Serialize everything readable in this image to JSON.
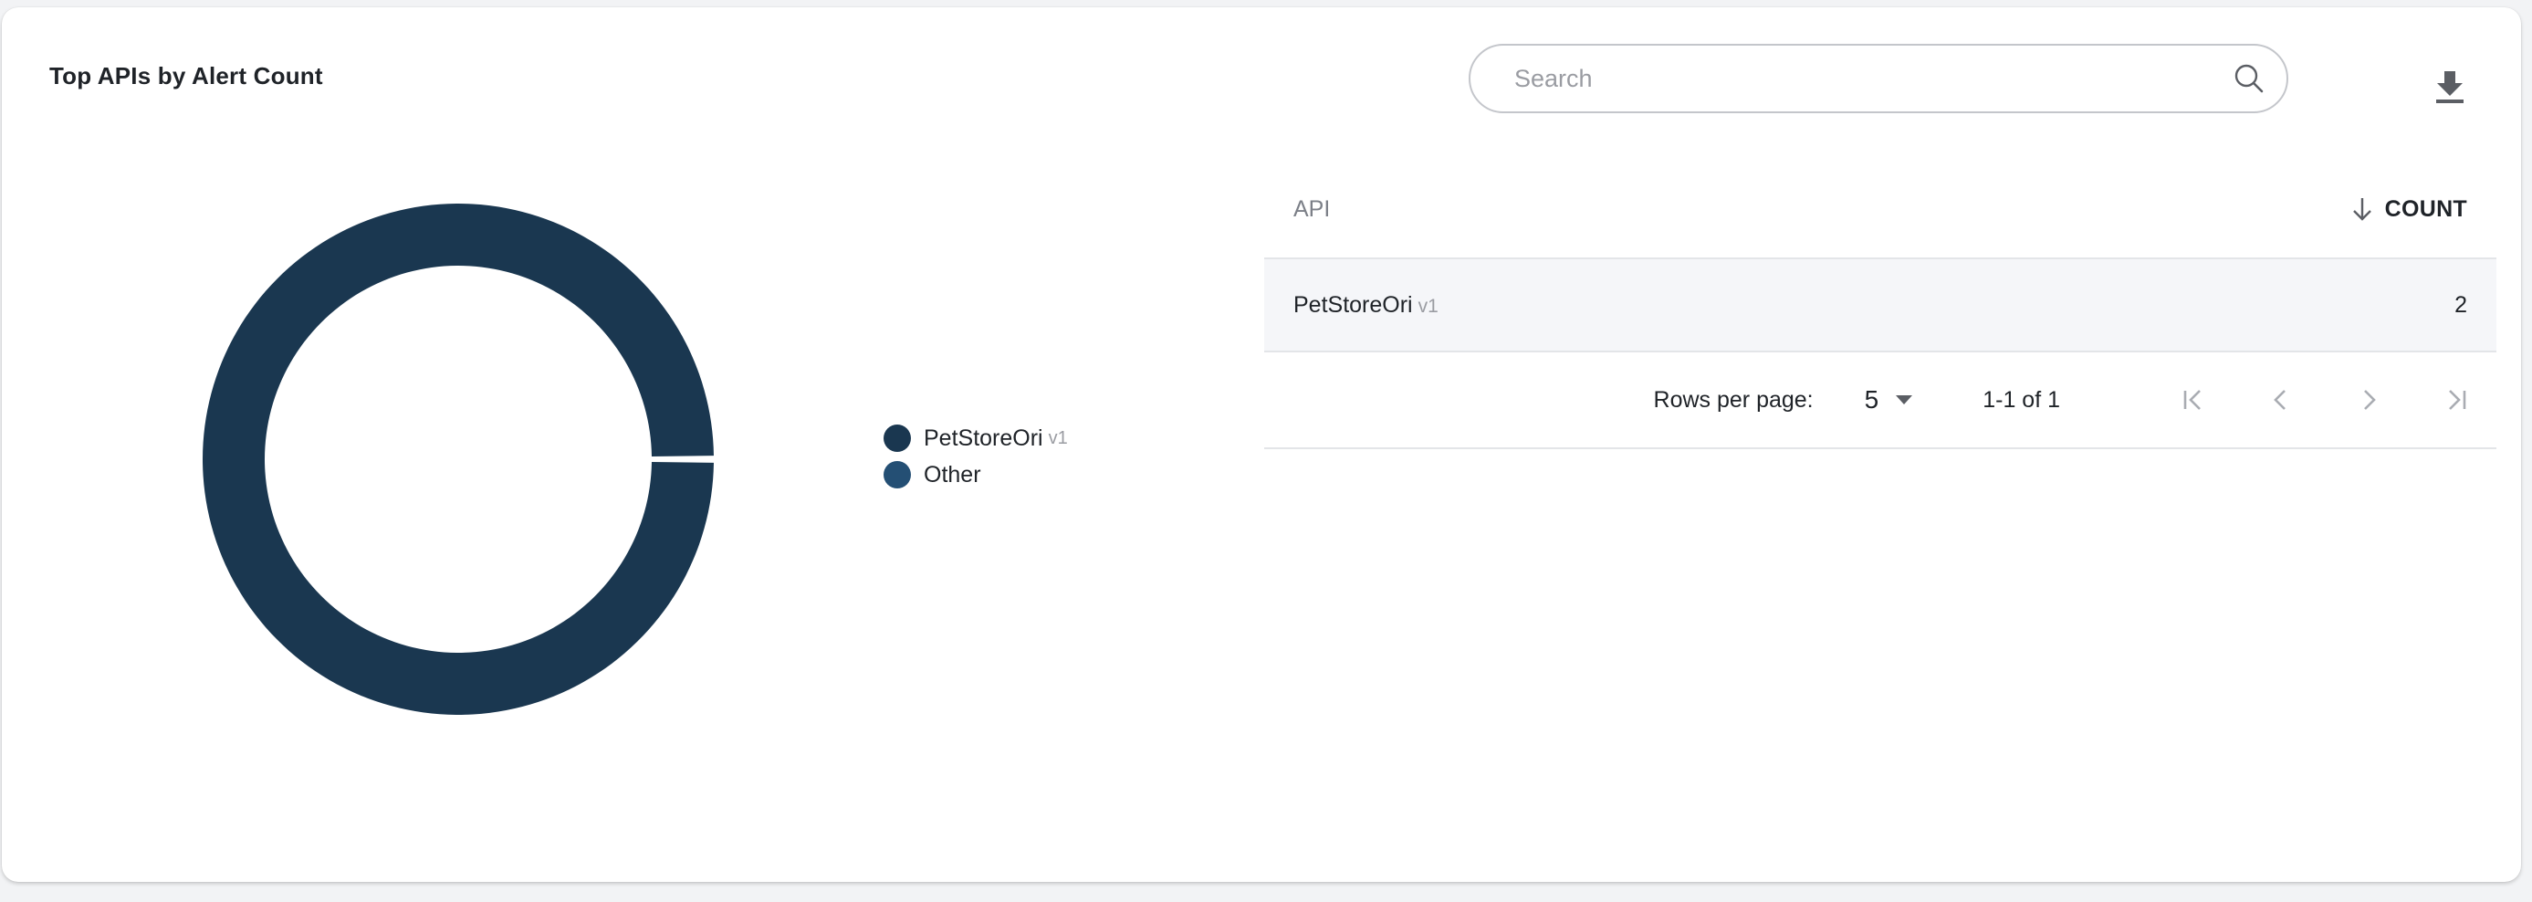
{
  "widget": {
    "title": "Top APIs by Alert Count"
  },
  "search": {
    "placeholder": "Search",
    "value": ""
  },
  "icons": {
    "search": "search-icon",
    "download": "download-icon",
    "sort": "arrow-down-icon",
    "dropdown": "caret-down-icon",
    "first": "first-page-icon",
    "prev": "chevron-left-icon",
    "next": "chevron-right-icon",
    "last": "last-page-icon"
  },
  "colors": {
    "petstore": "#1a3750",
    "other": "#244f74",
    "row_bg": "#f5f6f9",
    "muted": "#9a9ca2"
  },
  "legend": [
    {
      "label": "PetStoreOri",
      "version": "v1",
      "color": "#1a3750"
    },
    {
      "label": "Other",
      "version": "",
      "color": "#244f74"
    }
  ],
  "table": {
    "col_api": "API",
    "col_count": "COUNT",
    "rows": [
      {
        "api": "PetStoreOri",
        "version": "v1",
        "count": "2"
      }
    ]
  },
  "pagination": {
    "rows_per_page_label": "Rows per page:",
    "rows_per_page_value": "5",
    "range": "1-1 of 1"
  },
  "chart_data": {
    "type": "pie",
    "variant": "donut",
    "categories": [
      "PetStoreOri v1",
      "Other"
    ],
    "values": [
      2,
      0
    ]
  }
}
